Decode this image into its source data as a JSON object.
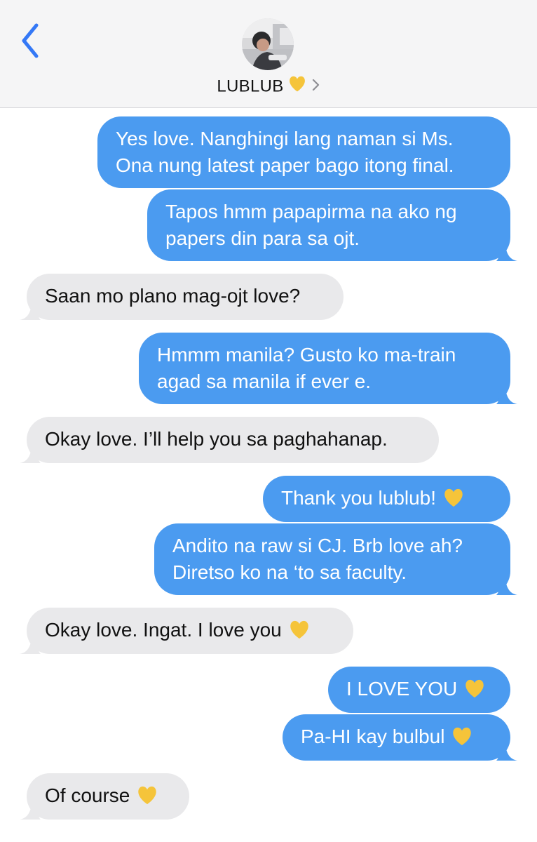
{
  "header": {
    "contact_name": "LUBLUB"
  },
  "colors": {
    "sent_bubble": "#4b9bf0",
    "received_bubble": "#e9e9eb",
    "accent_blue": "#3478f6",
    "heart": "#f5c43a"
  },
  "icons": {
    "back": "chevron-left-icon",
    "heart": "yellow-heart-icon",
    "disclosure": "chevron-right-icon"
  },
  "messages": [
    {
      "from": "me",
      "lines": [
        "Yes love. Nanghingi lang naman si Ms.",
        "Ona nung latest paper bago itong final."
      ]
    },
    {
      "from": "me",
      "lines": [
        "Tapos hmm papapirma na ako ng",
        "papers din para sa ojt."
      ]
    },
    {
      "from": "them",
      "lines": [
        "Saan mo plano mag-ojt love?"
      ]
    },
    {
      "from": "me",
      "lines": [
        "Hmmm manila? Gusto ko ma-train",
        "agad sa manila if ever e."
      ]
    },
    {
      "from": "them",
      "lines": [
        "Okay love. I’ll help you sa paghahanap."
      ]
    },
    {
      "from": "me",
      "lines": [
        "Thank you lublub!"
      ],
      "heart": true
    },
    {
      "from": "me",
      "lines": [
        "Andito na raw si CJ. Brb love ah?",
        "Diretso ko na ‘to sa faculty."
      ]
    },
    {
      "from": "them",
      "lines": [
        "Okay love. Ingat. I love you"
      ],
      "heart": true
    },
    {
      "from": "me",
      "lines": [
        "I LOVE YOU"
      ],
      "heart": true
    },
    {
      "from": "me",
      "lines": [
        "Pa-HI kay bulbul"
      ],
      "heart": true
    },
    {
      "from": "them",
      "lines": [
        "Of course"
      ],
      "heart": true
    }
  ]
}
